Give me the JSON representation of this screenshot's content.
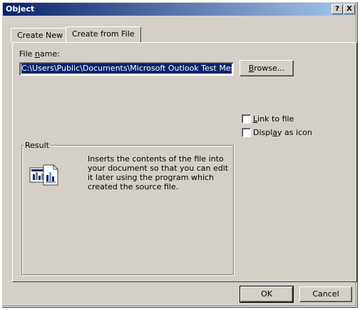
{
  "window": {
    "title": "Object",
    "help_button": "?",
    "close_button": "X"
  },
  "tabs": [
    {
      "label": "Create New",
      "selected": false
    },
    {
      "label": "Create from File",
      "selected": true
    }
  ],
  "file": {
    "label_pre": "File ",
    "label_accel": "n",
    "label_post": "ame:",
    "value": "C:\\Users\\Public\\Documents\\Microsoft Outlook Test Message.m"
  },
  "browse": {
    "accel": "B",
    "rest": "rowse..."
  },
  "options": {
    "link_accel": "L",
    "link_rest": "ink to file",
    "link_checked": false,
    "display_pre": "Displ",
    "display_accel": "a",
    "display_post": "y as icon",
    "display_checked": false
  },
  "result": {
    "title": "Result",
    "text": "Inserts the contents of the file into your document so that you can edit it later using the program which created the source file.",
    "icon": "insert-file-object-icon"
  },
  "footer": {
    "ok_label": "OK",
    "cancel_label": "Cancel"
  },
  "colors": {
    "face": "#d4d0c8",
    "title_start": "#0a246a",
    "title_end": "#a6caf0",
    "selection": "#0a246a"
  }
}
